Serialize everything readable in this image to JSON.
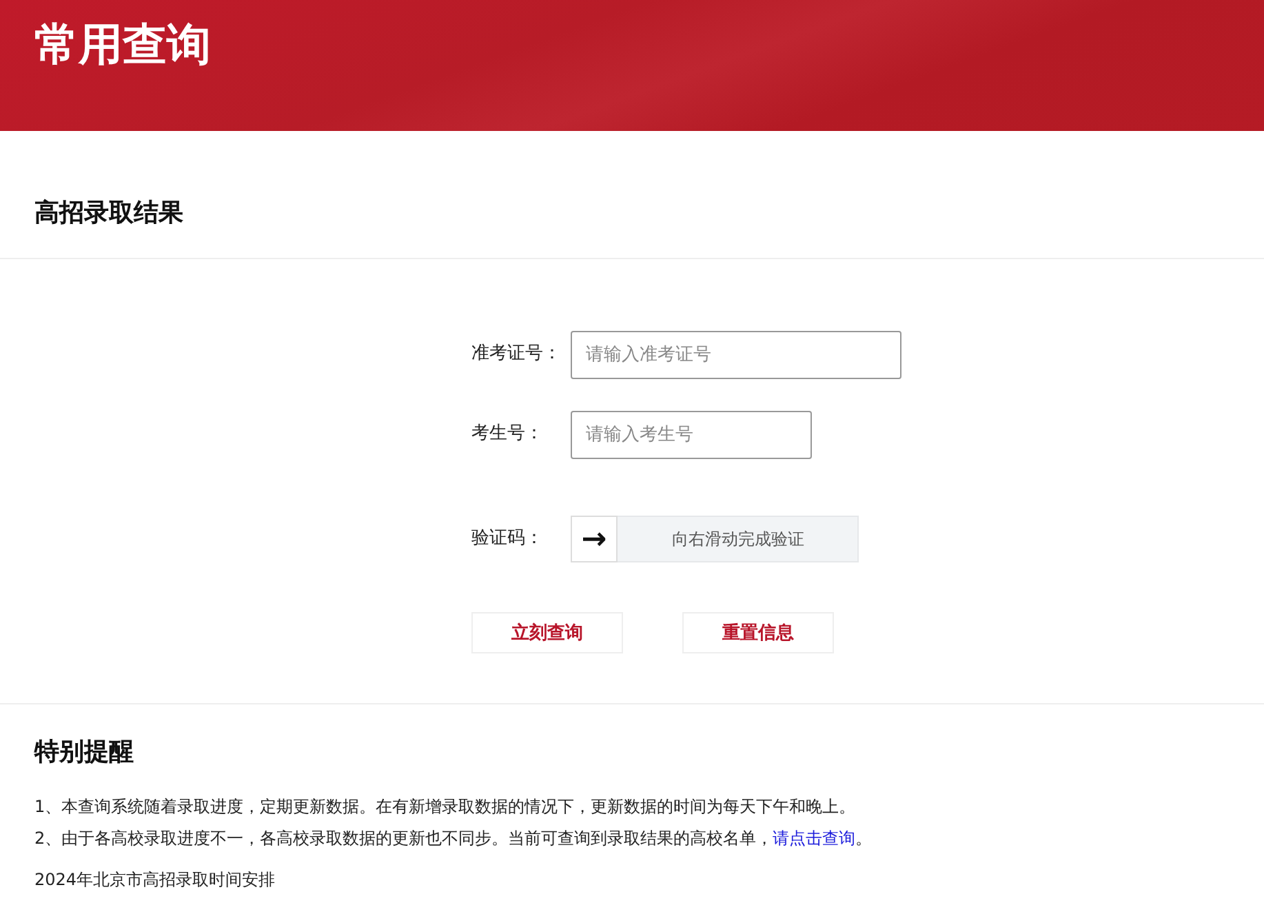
{
  "header": {
    "title": "常用查询"
  },
  "section": {
    "title": "高招录取结果"
  },
  "form": {
    "fields": [
      {
        "label": "准考证号：",
        "placeholder": "请输入准考证号",
        "kind": "long"
      },
      {
        "label": "考生号：",
        "placeholder": "请输入考生号",
        "kind": "short"
      }
    ],
    "captcha": {
      "label": "验证码：",
      "handle": "→",
      "hint": "向右滑动完成验证",
      "level": 0
    },
    "buttons": [
      "立刻查询",
      "重置信息"
    ]
  },
  "notice": {
    "title": "特别提醒",
    "items": [
      {
        "text": "1、本查询系统随着录取进度，定期更新数据。在有新增录取数据的情况下，更新数据的时间为每天下午和晚上。"
      },
      {
        "text": "2、由于各高校录取进度不一，各高校录取数据的更新也不同步。当前可查询到录取结果的高校名单，",
        "link": "请点击查询",
        "after": "。"
      }
    ],
    "footer": "2024年北京市高招录取时间安排"
  }
}
